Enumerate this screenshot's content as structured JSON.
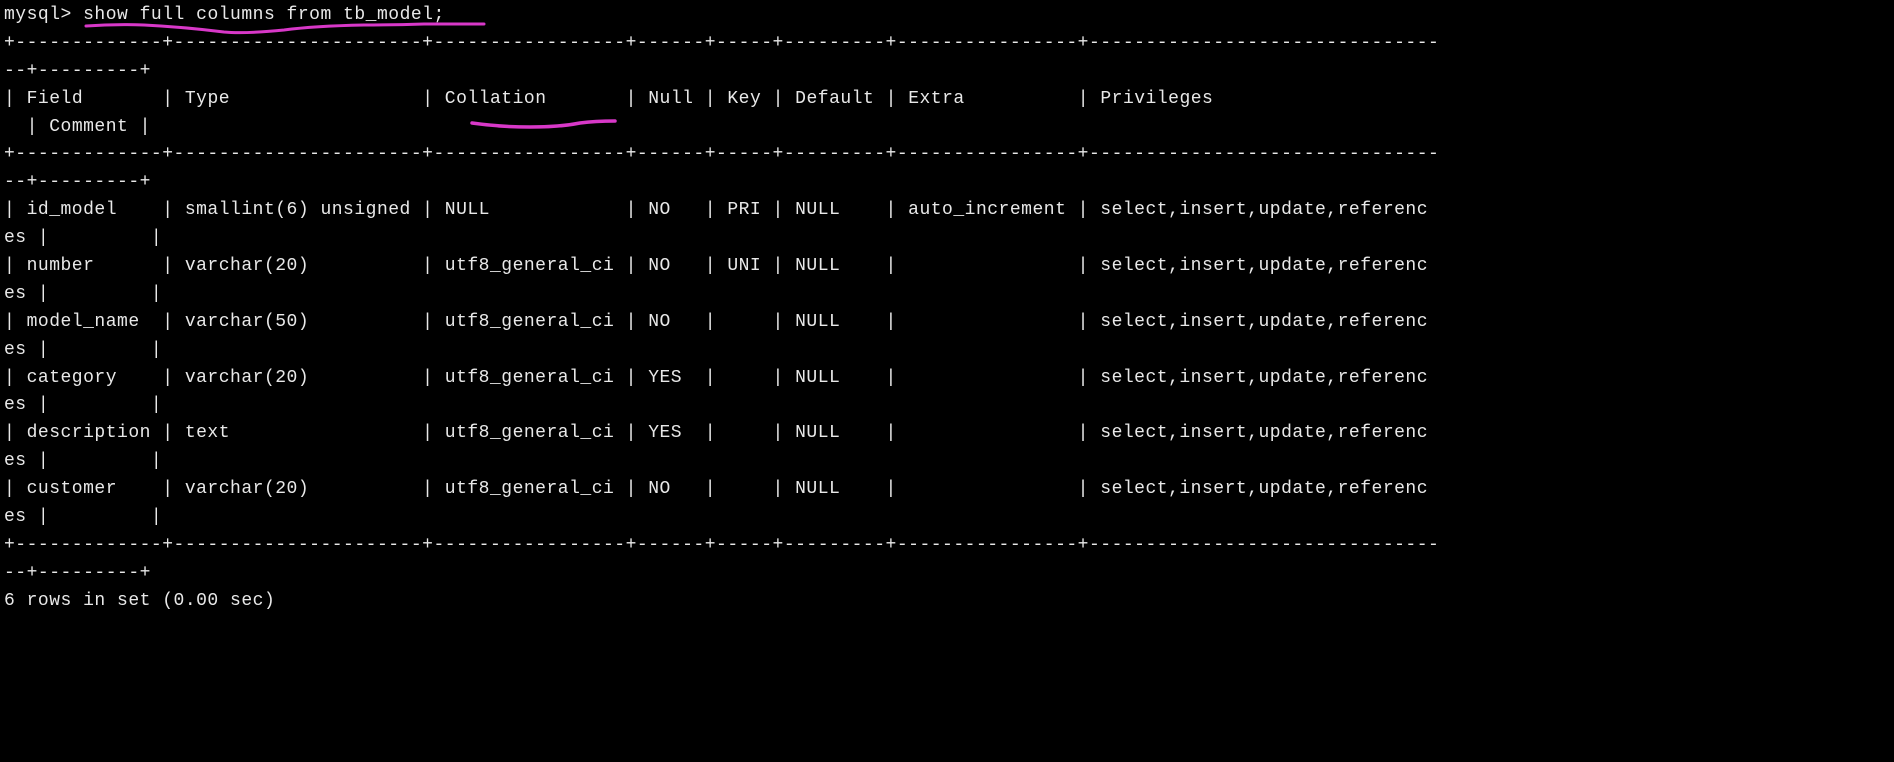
{
  "prompt": "mysql>",
  "command": "show full columns from tb_model;",
  "headers": {
    "field": "Field",
    "type": "Type",
    "collation": "Collation",
    "null": "Null",
    "key": "Key",
    "default": "Default",
    "extra": "Extra",
    "privileges": "Privileges",
    "comment": "Comment"
  },
  "rows": [
    {
      "field": "id_model",
      "type": "smallint(6) unsigned",
      "collation": "NULL",
      "null": "NO",
      "key": "PRI",
      "default": "NULL",
      "extra": "auto_increment",
      "privileges": "select,insert,update,referenc",
      "privileges_wrap": "es",
      "comment": ""
    },
    {
      "field": "number",
      "type": "varchar(20)",
      "collation": "utf8_general_ci",
      "null": "NO",
      "key": "UNI",
      "default": "NULL",
      "extra": "",
      "privileges": "select,insert,update,referenc",
      "privileges_wrap": "es",
      "comment": ""
    },
    {
      "field": "model_name",
      "type": "varchar(50)",
      "collation": "utf8_general_ci",
      "null": "NO",
      "key": "",
      "default": "NULL",
      "extra": "",
      "privileges": "select,insert,update,referenc",
      "privileges_wrap": "es",
      "comment": ""
    },
    {
      "field": "category",
      "type": "varchar(20)",
      "collation": "utf8_general_ci",
      "null": "YES",
      "key": "",
      "default": "NULL",
      "extra": "",
      "privileges": "select,insert,update,referenc",
      "privileges_wrap": "es",
      "comment": ""
    },
    {
      "field": "description",
      "type": "text",
      "collation": "utf8_general_ci",
      "null": "YES",
      "key": "",
      "default": "NULL",
      "extra": "",
      "privileges": "select,insert,update,referenc",
      "privileges_wrap": "es",
      "comment": ""
    },
    {
      "field": "customer",
      "type": "varchar(20)",
      "collation": "utf8_general_ci",
      "null": "NO",
      "key": "",
      "default": "NULL",
      "extra": "",
      "privileges": "select,insert,update,referenc",
      "privileges_wrap": "es",
      "comment": ""
    }
  ],
  "footer": "6 rows in set (0.00 sec)",
  "separator_main": "+-------------+----------------------+-----------------+------+-----+---------+----------------+-------------------------------",
  "separator_wrap": "--+---------+"
}
